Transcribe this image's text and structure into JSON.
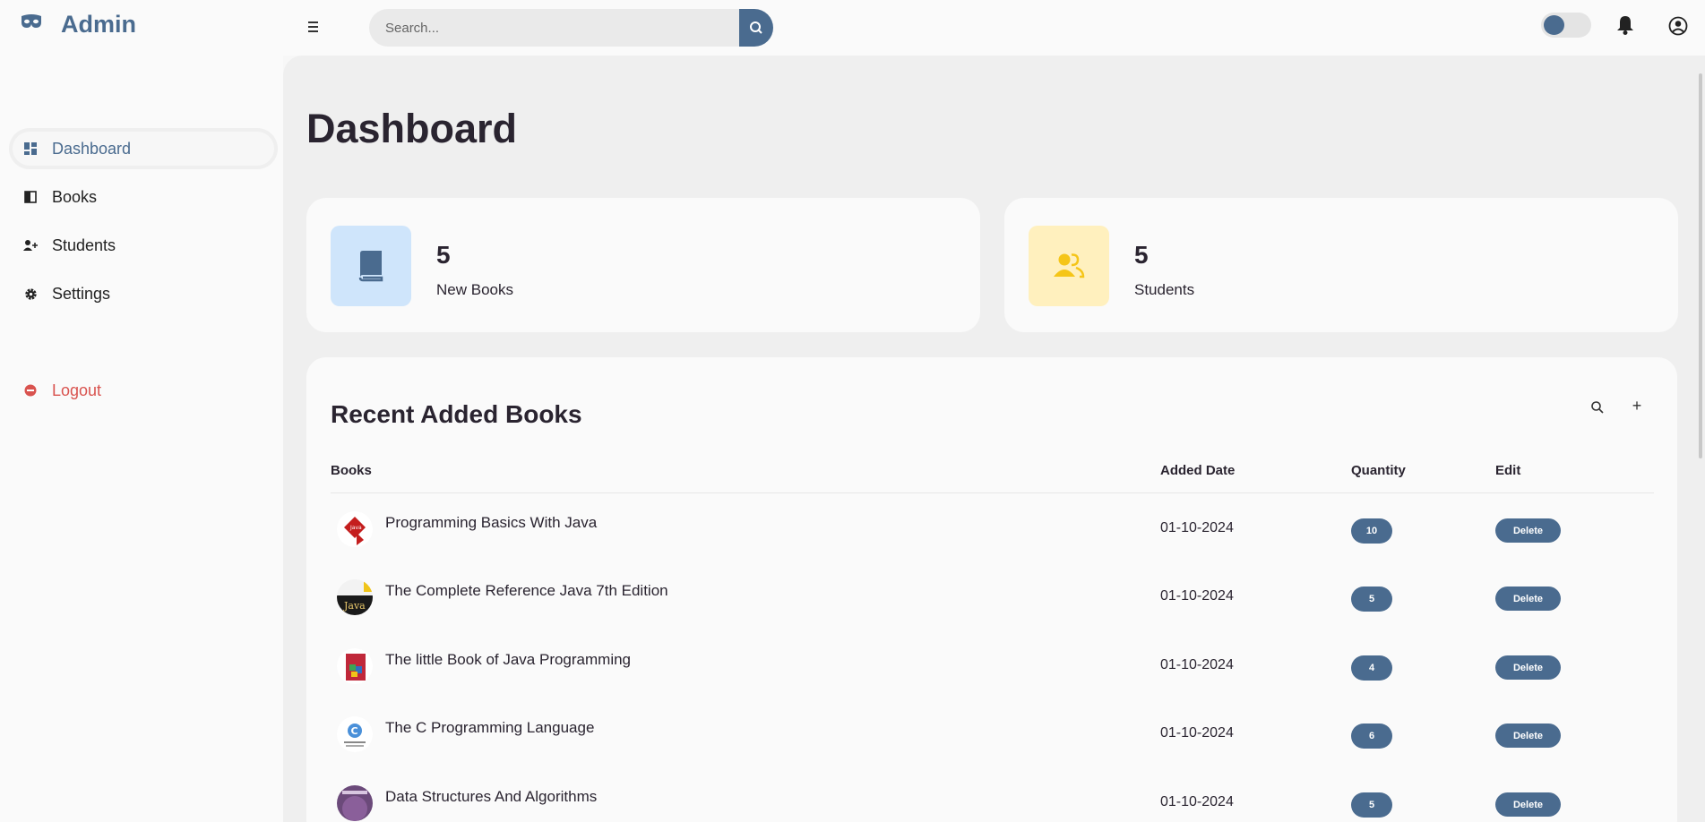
{
  "app": {
    "brand": "Admin"
  },
  "search": {
    "placeholder": "Search..."
  },
  "sidebar": {
    "items": [
      {
        "label": "Dashboard",
        "icon": "dashboard-icon"
      },
      {
        "label": "Books",
        "icon": "book-icon"
      },
      {
        "label": "Students",
        "icon": "add-user-icon"
      },
      {
        "label": "Settings",
        "icon": "gear-icon"
      }
    ],
    "logout": {
      "label": "Logout",
      "icon": "logout-icon"
    }
  },
  "page": {
    "title": "Dashboard"
  },
  "cards": [
    {
      "value": "5",
      "caption": "New Books",
      "icon": "book-icon",
      "color": "#cfe5fb"
    },
    {
      "value": "5",
      "caption": "Students",
      "icon": "users-icon",
      "color": "#fff0be"
    }
  ],
  "recent": {
    "title": "Recent Added Books",
    "columns": [
      "Books",
      "Added Date",
      "Quantity",
      "Edit"
    ],
    "rows": [
      {
        "title": "Programming Basics With Java",
        "date": "01-10-2024",
        "quantity": "10",
        "action": "Delete"
      },
      {
        "title": "The Complete Reference Java 7th Edition",
        "date": "01-10-2024",
        "quantity": "5",
        "action": "Delete"
      },
      {
        "title": "The little Book of Java Programming",
        "date": "01-10-2024",
        "quantity": "4",
        "action": "Delete"
      },
      {
        "title": "The C Programming Language",
        "date": "01-10-2024",
        "quantity": "6",
        "action": "Delete"
      },
      {
        "title": "Data Structures And Algorithms",
        "date": "01-10-2024",
        "quantity": "5",
        "action": "Delete"
      }
    ]
  },
  "colors": {
    "accent": "#4a6b8f",
    "danger": "#d9534f",
    "background": "#efefef"
  }
}
